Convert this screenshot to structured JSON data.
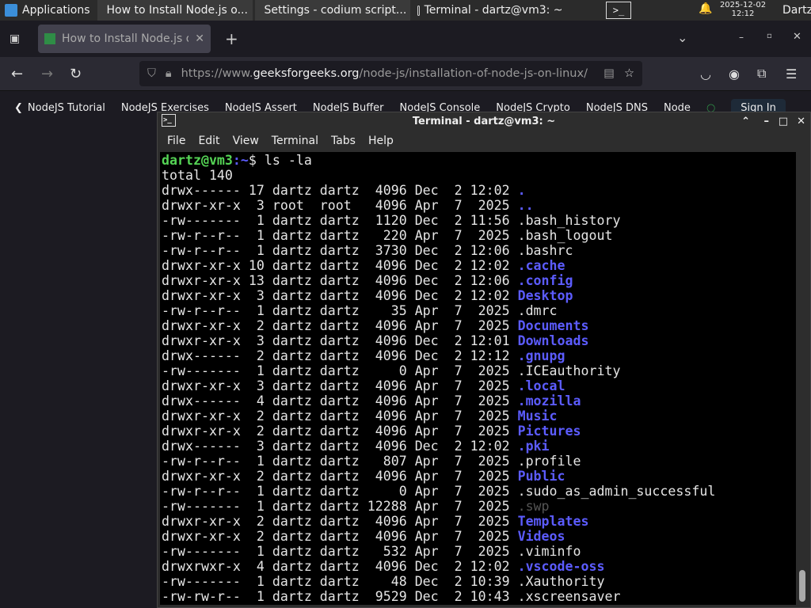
{
  "panel": {
    "apps": "Applications",
    "tasks": [
      "How to Install Node.js o...",
      "Settings - codium script...",
      "Terminal - dartz@vm3: ~"
    ],
    "date": "2025-12-02",
    "time": "12:12",
    "user": "Dartz"
  },
  "browser": {
    "tab_title": "How to Install Node.js on",
    "url_pre": "https://www.",
    "url_domain": "geeksforgeeks.org",
    "url_path": "/node-js/installation-of-node-js-on-linux/",
    "bookmarks": [
      "NodeJS Tutorial",
      "NodeJS Exercises",
      "NodeJS Assert",
      "NodeJS Buffer",
      "NodeJS Console",
      "NodeJS Crypto",
      "NodeJS DNS",
      "Node"
    ],
    "sign_in": "Sign In"
  },
  "terminal": {
    "title": "Terminal - dartz@vm3: ~",
    "menu": [
      "File",
      "Edit",
      "View",
      "Terminal",
      "Tabs",
      "Help"
    ],
    "prompt_user": "dartz@vm3",
    "prompt_path": ":~",
    "prompt_sym": "$ ",
    "command": "ls -la",
    "total": "total 140",
    "colors": {
      "dir": "#5c5cff",
      "prompt": "#55d455",
      "path": "#5c5cff"
    },
    "entries": [
      {
        "info": "drwx------ 17 dartz dartz  4096 Dec  2 12:02 ",
        "name": ".",
        "type": "dir"
      },
      {
        "info": "drwxr-xr-x  3 root  root   4096 Apr  7  2025 ",
        "name": "..",
        "type": "dir"
      },
      {
        "info": "-rw-------  1 dartz dartz  1120 Dec  2 11:56 ",
        "name": ".bash_history",
        "type": "file"
      },
      {
        "info": "-rw-r--r--  1 dartz dartz   220 Apr  7  2025 ",
        "name": ".bash_logout",
        "type": "file"
      },
      {
        "info": "-rw-r--r--  1 dartz dartz  3730 Dec  2 12:06 ",
        "name": ".bashrc",
        "type": "file"
      },
      {
        "info": "drwxr-xr-x 10 dartz dartz  4096 Dec  2 12:02 ",
        "name": ".cache",
        "type": "dir"
      },
      {
        "info": "drwxr-xr-x 13 dartz dartz  4096 Dec  2 12:06 ",
        "name": ".config",
        "type": "dir"
      },
      {
        "info": "drwxr-xr-x  3 dartz dartz  4096 Dec  2 12:02 ",
        "name": "Desktop",
        "type": "dir"
      },
      {
        "info": "-rw-r--r--  1 dartz dartz    35 Apr  7  2025 ",
        "name": ".dmrc",
        "type": "file"
      },
      {
        "info": "drwxr-xr-x  2 dartz dartz  4096 Apr  7  2025 ",
        "name": "Documents",
        "type": "dir"
      },
      {
        "info": "drwxr-xr-x  3 dartz dartz  4096 Dec  2 12:01 ",
        "name": "Downloads",
        "type": "dir"
      },
      {
        "info": "drwx------  2 dartz dartz  4096 Dec  2 12:12 ",
        "name": ".gnupg",
        "type": "dir"
      },
      {
        "info": "-rw-------  1 dartz dartz     0 Apr  7  2025 ",
        "name": ".ICEauthority",
        "type": "file"
      },
      {
        "info": "drwxr-xr-x  3 dartz dartz  4096 Apr  7  2025 ",
        "name": ".local",
        "type": "dir"
      },
      {
        "info": "drwx------  4 dartz dartz  4096 Apr  7  2025 ",
        "name": ".mozilla",
        "type": "dir"
      },
      {
        "info": "drwxr-xr-x  2 dartz dartz  4096 Apr  7  2025 ",
        "name": "Music",
        "type": "dir"
      },
      {
        "info": "drwxr-xr-x  2 dartz dartz  4096 Apr  7  2025 ",
        "name": "Pictures",
        "type": "dir"
      },
      {
        "info": "drwx------  3 dartz dartz  4096 Dec  2 12:02 ",
        "name": ".pki",
        "type": "dir"
      },
      {
        "info": "-rw-r--r--  1 dartz dartz   807 Apr  7  2025 ",
        "name": ".profile",
        "type": "file"
      },
      {
        "info": "drwxr-xr-x  2 dartz dartz  4096 Apr  7  2025 ",
        "name": "Public",
        "type": "dir"
      },
      {
        "info": "-rw-r--r--  1 dartz dartz     0 Apr  7  2025 ",
        "name": ".sudo_as_admin_successful",
        "type": "file"
      },
      {
        "info": "-rw-------  1 dartz dartz 12288 Apr  7  2025 ",
        "name": ".swp",
        "type": "dim"
      },
      {
        "info": "drwxr-xr-x  2 dartz dartz  4096 Apr  7  2025 ",
        "name": "Templates",
        "type": "dir"
      },
      {
        "info": "drwxr-xr-x  2 dartz dartz  4096 Apr  7  2025 ",
        "name": "Videos",
        "type": "dir"
      },
      {
        "info": "-rw-------  1 dartz dartz   532 Apr  7  2025 ",
        "name": ".viminfo",
        "type": "file"
      },
      {
        "info": "drwxrwxr-x  4 dartz dartz  4096 Dec  2 12:02 ",
        "name": ".vscode-oss",
        "type": "dir"
      },
      {
        "info": "-rw-------  1 dartz dartz    48 Dec  2 10:39 ",
        "name": ".Xauthority",
        "type": "file"
      },
      {
        "info": "-rw-rw-r--  1 dartz dartz  9529 Dec  2 10:43 ",
        "name": ".xscreensaver",
        "type": "file"
      }
    ]
  }
}
